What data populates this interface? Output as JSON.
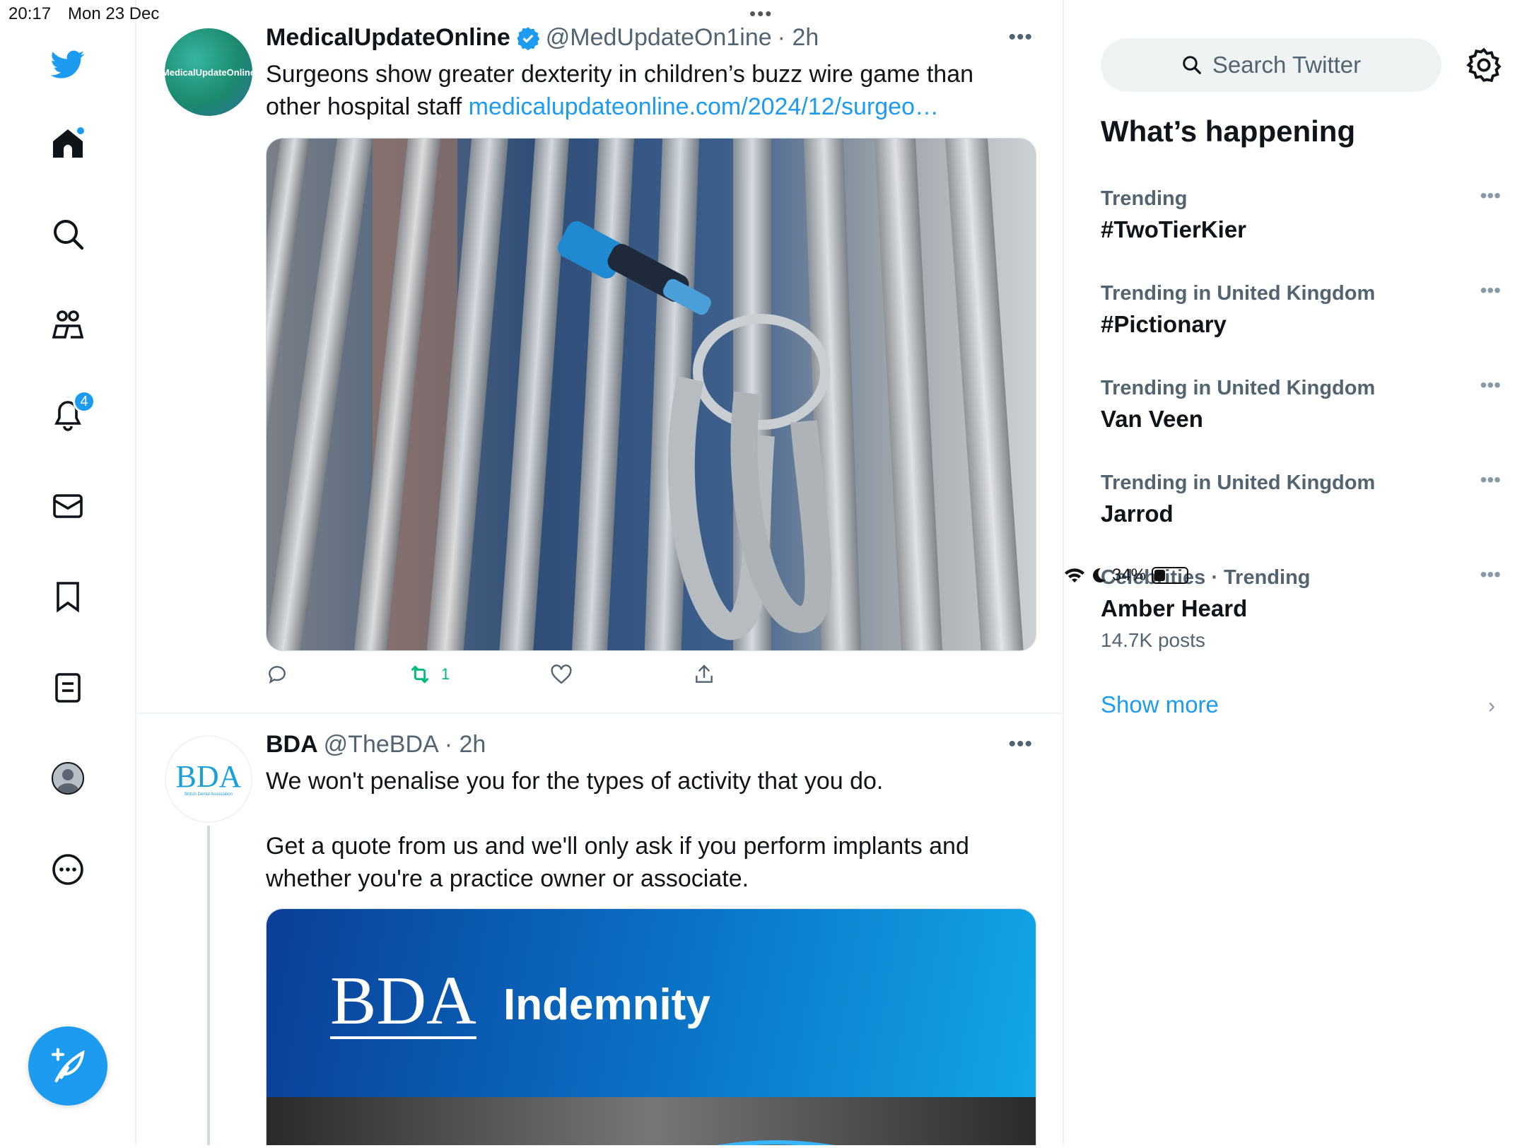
{
  "status_bar": {
    "time": "20:17",
    "date": "Mon 23 Dec",
    "battery": "34%",
    "battery_level": 0.34
  },
  "nav": {
    "icons": [
      "twitter-logo",
      "home-icon",
      "search-icon",
      "communities-icon",
      "notifications-icon",
      "messages-icon",
      "bookmarks-icon",
      "lists-icon",
      "profile-icon",
      "more-icon"
    ],
    "notifications_count": "4",
    "compose_icon": "compose-icon"
  },
  "feed": {
    "tweets": [
      {
        "name": "MedicalUpdateOnline",
        "verified": true,
        "handle": "@MedUpdateOn1ine",
        "time": "· 2h",
        "text": "Surgeons show greater dexterity in children’s buzz wire game than other hospital staff ",
        "link": "medicalupdateonline.com/2024/12/surgeo…",
        "avatar_text": "MedicalUpdateOnline",
        "retweets": "1"
      },
      {
        "name": "BDA",
        "handle": "@TheBDA",
        "time": "· 2h",
        "text_line1": "We won't penalise you for the types of activity that you do.",
        "text_line2": "Get a quote from us and we'll only ask if you perform implants and whether you're a practice owner or associate.",
        "avatar_text": "BDA",
        "avatar_subtext": "British Dental Association",
        "media_logo": "BDA",
        "media_title": "Indemnity"
      }
    ]
  },
  "sidebar": {
    "search_placeholder": "Search Twitter",
    "title": "What’s happening",
    "trends": [
      {
        "context": "Trending",
        "topic": "#TwoTierKier"
      },
      {
        "context": "Trending in United Kingdom",
        "topic": "#Pictionary"
      },
      {
        "context": "Trending in United Kingdom",
        "topic": "Van Veen"
      },
      {
        "context": "Trending in United Kingdom",
        "topic": "Jarrod"
      },
      {
        "context": "Celebrities · Trending",
        "topic": "Amber Heard",
        "posts": "14.7K posts"
      }
    ],
    "show_more": "Show more"
  },
  "colors": {
    "accent": "#1d9bf0",
    "retweet_green": "#00ba7c",
    "secondary_text": "#536471"
  }
}
